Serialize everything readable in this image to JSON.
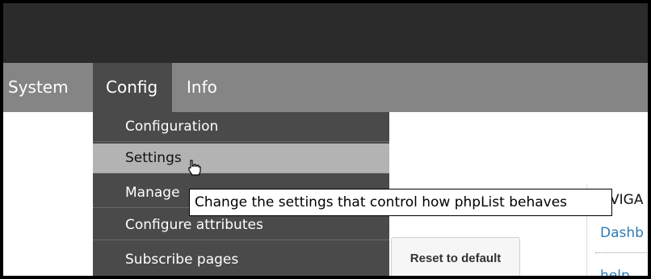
{
  "nav": {
    "items": [
      {
        "label": "System"
      },
      {
        "label": "Config"
      },
      {
        "label": "Info"
      }
    ]
  },
  "dropdown": {
    "items": [
      {
        "label": "Configuration"
      },
      {
        "label": "Settings"
      },
      {
        "label": "Manage"
      },
      {
        "label": "Configure attributes"
      },
      {
        "label": "Subscribe pages"
      }
    ]
  },
  "tooltip": "Change the settings that control how phpList behaves",
  "reset_button": "Reset to default",
  "side_panel": {
    "title": "VIGA",
    "links": [
      {
        "label": "Dashb"
      },
      {
        "label": "help"
      }
    ]
  },
  "cursor": {
    "icon": "hand-pointer-icon"
  }
}
